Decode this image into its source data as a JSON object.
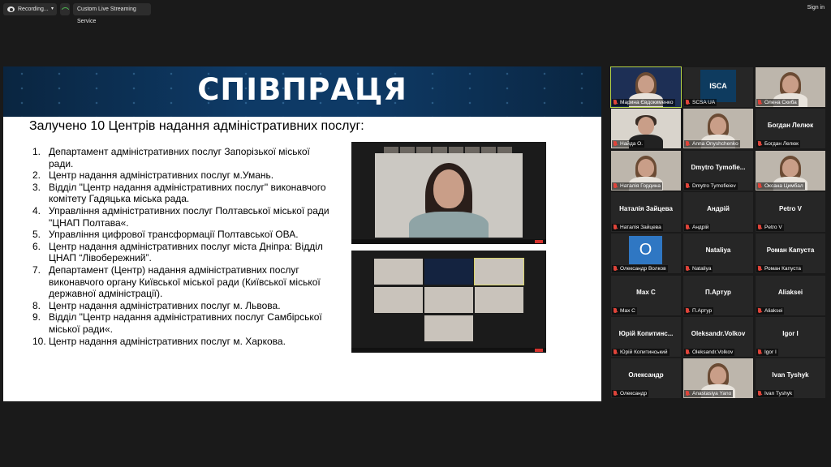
{
  "topbar": {
    "recording_label": "Recording...",
    "recording_caret": "▾",
    "stream_label": "Custom Live Streaming Service",
    "signin_label": "Sign in"
  },
  "slide": {
    "title": "СПІВПРАЦЯ",
    "subtitle": "Залучено 10 Центрів надання адміністративних послуг:",
    "items": [
      {
        "num": "1.",
        "text": "Департамент адміністративних послуг Запорізької міської ради."
      },
      {
        "num": "2.",
        "text": "Центр надання адміністративних послуг м.Умань."
      },
      {
        "num": "3.",
        "text": "Відділ \"Центр надання адміністративних послуг\" виконавчого комітету Гадяцька міська рада."
      },
      {
        "num": "4.",
        "text": "Управління адміністративних послуг Полтавської міської ради \"ЦНАП Полтава«."
      },
      {
        "num": "5.",
        "text": "Управління цифрової трансформації Полтавської ОВА."
      },
      {
        "num": "6.",
        "text": "Центр надання адміністративних послуг міста Дніпра: Відділ ЦНАП “Лівобережний”."
      },
      {
        "num": "7.",
        "text": "Департамент (Центр) надання адміністративних послуг виконавчого органу Київської міської ради (Київської міської державної адміністрації)."
      },
      {
        "num": "8.",
        "text": "Центр надання адміністративних послуг м. Львова."
      },
      {
        "num": "9.",
        "text": "Відділ \"Центр надання адміністративних послуг Самбірської міської ради«."
      },
      {
        "num": "10.",
        "text": "Центр надання адміністративних послуг м. Харкова."
      }
    ]
  },
  "participants": [
    {
      "label": "Марина Євдокименко",
      "big": "",
      "kind": "video-woman"
    },
    {
      "label": "SCSA UA",
      "big": "",
      "kind": "logo-isca"
    },
    {
      "label": "Олена Скиба",
      "big": "",
      "kind": "video-woman"
    },
    {
      "label": "Найда О.",
      "big": "",
      "kind": "video-man"
    },
    {
      "label": "Anna Onyshchenko",
      "big": "",
      "kind": "video-woman"
    },
    {
      "label": "Богдан Лелюк",
      "big": "Богдан Лелюк",
      "kind": "name"
    },
    {
      "label": "Наталія Гордина",
      "big": "",
      "kind": "video-woman"
    },
    {
      "label": "Dmytro Tymofieiev",
      "big": "Dmytro Tymofie...",
      "kind": "name"
    },
    {
      "label": "Оксана Цимбал",
      "big": "",
      "kind": "video-woman"
    },
    {
      "label": "Наталія Зайцева",
      "big": "Наталія Зайцева",
      "kind": "name"
    },
    {
      "label": "Андрій",
      "big": "Андрій",
      "kind": "name"
    },
    {
      "label": "Petro V",
      "big": "Petro V",
      "kind": "name"
    },
    {
      "label": "Олександр Волков",
      "big": "",
      "kind": "logo-o"
    },
    {
      "label": "Nataliya",
      "big": "Nataliya",
      "kind": "name"
    },
    {
      "label": "Роман Капуста",
      "big": "Роман Капуста",
      "kind": "name"
    },
    {
      "label": "Мах С",
      "big": "Мах С",
      "kind": "name"
    },
    {
      "label": "П.Артур",
      "big": "П.Артур",
      "kind": "name"
    },
    {
      "label": "Aliaksei",
      "big": "Aliaksei",
      "kind": "name"
    },
    {
      "label": "Юрій Копитинський",
      "big": "Юрій Копитинс...",
      "kind": "name"
    },
    {
      "label": "Oleksandr.Volkov",
      "big": "Oleksandr.Volkov",
      "kind": "name"
    },
    {
      "label": "Igor I",
      "big": "Igor I",
      "kind": "name"
    },
    {
      "label": "Олександр",
      "big": "Олександр",
      "kind": "name"
    },
    {
      "label": "Anastasiya Yano",
      "big": "",
      "kind": "video-woman"
    },
    {
      "label": "Ivan Tyshyk",
      "big": "Ivan Tyshyk",
      "kind": "name"
    }
  ],
  "logo_o_text": "O",
  "isca_text": "ISCA",
  "colors": {
    "active_speaker": "#b7d649",
    "mic_muted": "#e0443a",
    "leave": "#d4332e"
  }
}
